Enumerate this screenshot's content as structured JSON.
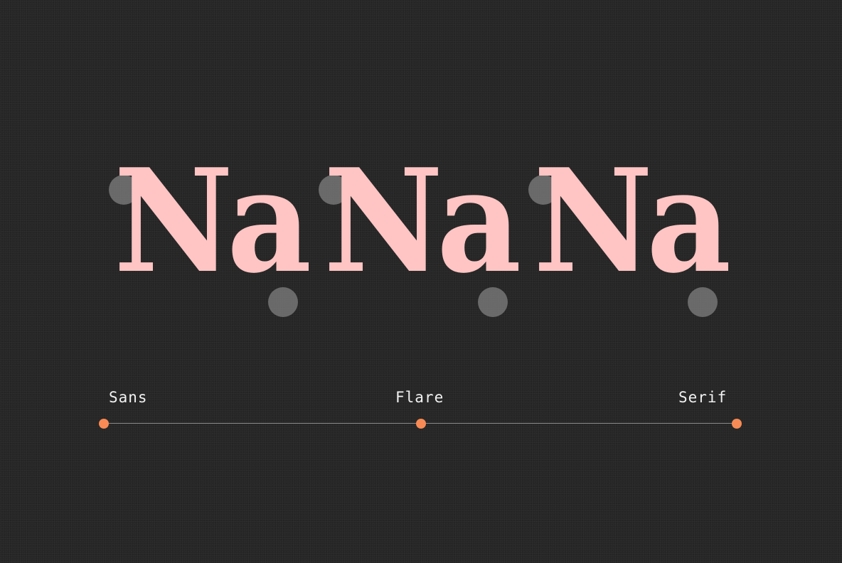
{
  "specimens": [
    {
      "text": "Na"
    },
    {
      "text": "Na"
    },
    {
      "text": "Na"
    }
  ],
  "axis": {
    "labels": [
      "Sans",
      "Flare",
      "Serif"
    ],
    "stop_color": "#f88a55",
    "line_color": "#8c8c8c"
  },
  "colors": {
    "background": "#262626",
    "glyph": "#ffc5c4",
    "handle": "#a0a0a0",
    "label": "#f2f2f2"
  }
}
